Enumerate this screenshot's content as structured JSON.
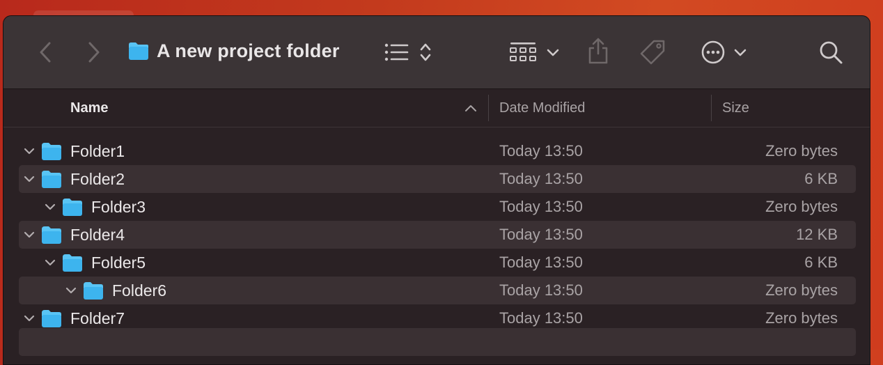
{
  "window": {
    "title": "A new project folder"
  },
  "columns": {
    "name": "Name",
    "date": "Date Modified",
    "size": "Size"
  },
  "rows": [
    {
      "name": "Folder1",
      "date": "Today 13:50",
      "size": "Zero bytes",
      "level": 0,
      "expanded": true
    },
    {
      "name": "Folder2",
      "date": "Today 13:50",
      "size": "6 KB",
      "level": 0,
      "expanded": true
    },
    {
      "name": "Folder3",
      "date": "Today 13:50",
      "size": "Zero bytes",
      "level": 1,
      "expanded": true
    },
    {
      "name": "Folder4",
      "date": "Today 13:50",
      "size": "12 KB",
      "level": 0,
      "expanded": true
    },
    {
      "name": "Folder5",
      "date": "Today 13:50",
      "size": "6 KB",
      "level": 1,
      "expanded": true
    },
    {
      "name": "Folder6",
      "date": "Today 13:50",
      "size": "Zero bytes",
      "level": 2,
      "expanded": true
    },
    {
      "name": "Folder7",
      "date": "Today 13:50",
      "size": "Zero bytes",
      "level": 0,
      "expanded": true
    }
  ],
  "icons": {
    "back": "chevron-left-icon",
    "forward": "chevron-right-icon",
    "folder": "folder-icon",
    "list_view": "list-view-icon",
    "sort": "up-down-chevron-icon",
    "group": "grid-icon",
    "share": "share-icon",
    "tag": "tag-icon",
    "more": "ellipsis-circle-icon",
    "search": "search-icon"
  },
  "colors": {
    "folder": "#3db4ee",
    "folder_tab": "#59c4f4",
    "background": "#2a2124",
    "toolbar": "#3b3436"
  }
}
